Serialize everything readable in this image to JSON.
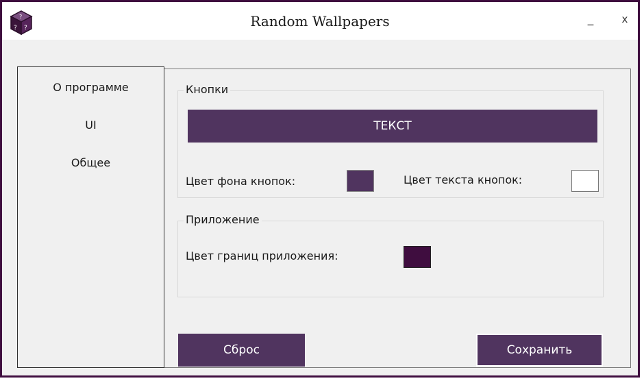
{
  "window": {
    "title": "Random Wallpapers",
    "minimize_glyph": "_",
    "close_glyph": "x",
    "icon": "dice-icon",
    "border_color": "#3f0d3f"
  },
  "sidebar": {
    "items": [
      {
        "label": "О программе"
      },
      {
        "label": "UI"
      },
      {
        "label": "Общее"
      }
    ]
  },
  "buttons_group": {
    "title": "Кнопки",
    "preview_label": "ТЕКСТ",
    "bg_color_label": "Цвет фона кнопок:",
    "bg_color": "#50345f",
    "text_color_label": "Цвет текста кнопок:",
    "text_color": "#ffffff"
  },
  "app_group": {
    "title": "Приложение",
    "border_color_label": "Цвет границ приложения:",
    "border_color": "#3f0d3f"
  },
  "actions": {
    "reset_label": "Сброс",
    "save_label": "Сохранить"
  }
}
